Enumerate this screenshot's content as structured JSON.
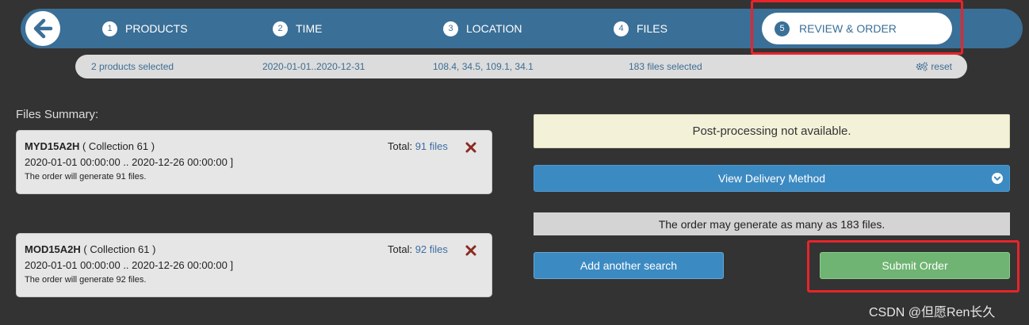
{
  "steps": [
    {
      "num": "1",
      "label": "PRODUCTS"
    },
    {
      "num": "2",
      "label": "TIME"
    },
    {
      "num": "3",
      "label": "LOCATION"
    },
    {
      "num": "4",
      "label": "FILES"
    },
    {
      "num": "5",
      "label": "REVIEW & ORDER"
    }
  ],
  "summary": {
    "products": "2 products selected",
    "time": "2020-01-01..2020-12-31",
    "location": "108.4, 34.5, 109.1, 34.1",
    "files": "183 files selected",
    "reset": "reset"
  },
  "files_summary": {
    "title": "Files Summary:",
    "cards": [
      {
        "name": "MYD15A2H",
        "collection": "( Collection 61 )",
        "range": "2020-01-01 00:00:00 .. 2020-12-26 00:00:00 ]",
        "note": "The order will generate 91 files.",
        "total_label": "Total:",
        "total_link": "91 files"
      },
      {
        "name": "MOD15A2H",
        "collection": "( Collection 61 )",
        "range": "2020-01-01 00:00:00 .. 2020-12-26 00:00:00 ]",
        "note": "The order will generate 92 files.",
        "total_label": "Total:",
        "total_link": "92 files"
      }
    ]
  },
  "order_panel": {
    "notice": "Post-processing not available.",
    "delivery_button": "View Delivery Method",
    "generate_note": "The order may generate as many as 183 files.",
    "add_search_button": "Add another search",
    "submit_button": "Submit Order"
  },
  "watermark": "CSDN @但愿Ren长久",
  "colors": {
    "background": "#333333",
    "step_bar": "#3a6f97",
    "primary_button": "#3c8ac2",
    "submit_button": "#6fb472",
    "highlight": "#e8242a",
    "remove_icon": "#8b2a22"
  },
  "icons": {
    "back": "arrow-left-icon",
    "reset": "gears-icon",
    "remove": "close-x-icon",
    "dropdown": "chevron-down-circle-icon"
  }
}
